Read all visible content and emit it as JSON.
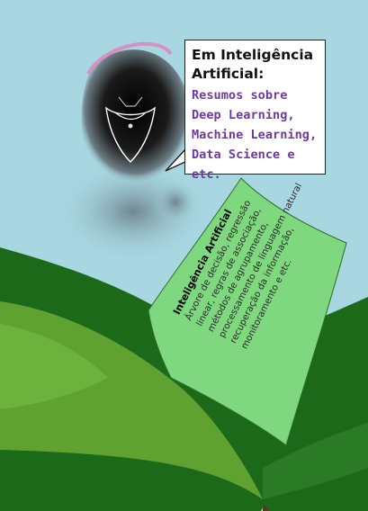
{
  "bubble": {
    "title": "Em Inteligência Artificial:",
    "subtitle_lines": [
      "Resumos sobre",
      "Deep Learning,",
      "Machine Learning,",
      "Data Science e etc."
    ]
  },
  "book_page": {
    "title": "Inteligência Artificial",
    "lines": [
      "Árvore de decisão, regressão",
      "linear, regras de associação,",
      "métodos de agrupamento,",
      "processamento de linguagem natural",
      "recuperação da informação,",
      "monitoramento e etc."
    ]
  },
  "colors": {
    "background": "#a8d7e2",
    "book_page_light": "#7fd87f",
    "book_green_mid": "#5fa232",
    "book_green_dark": "#1c6a19",
    "subtitle_purple": "#6b3aa2"
  },
  "icons": [
    "robot-icon",
    "open-book-icon",
    "speech-bubble-icon"
  ]
}
